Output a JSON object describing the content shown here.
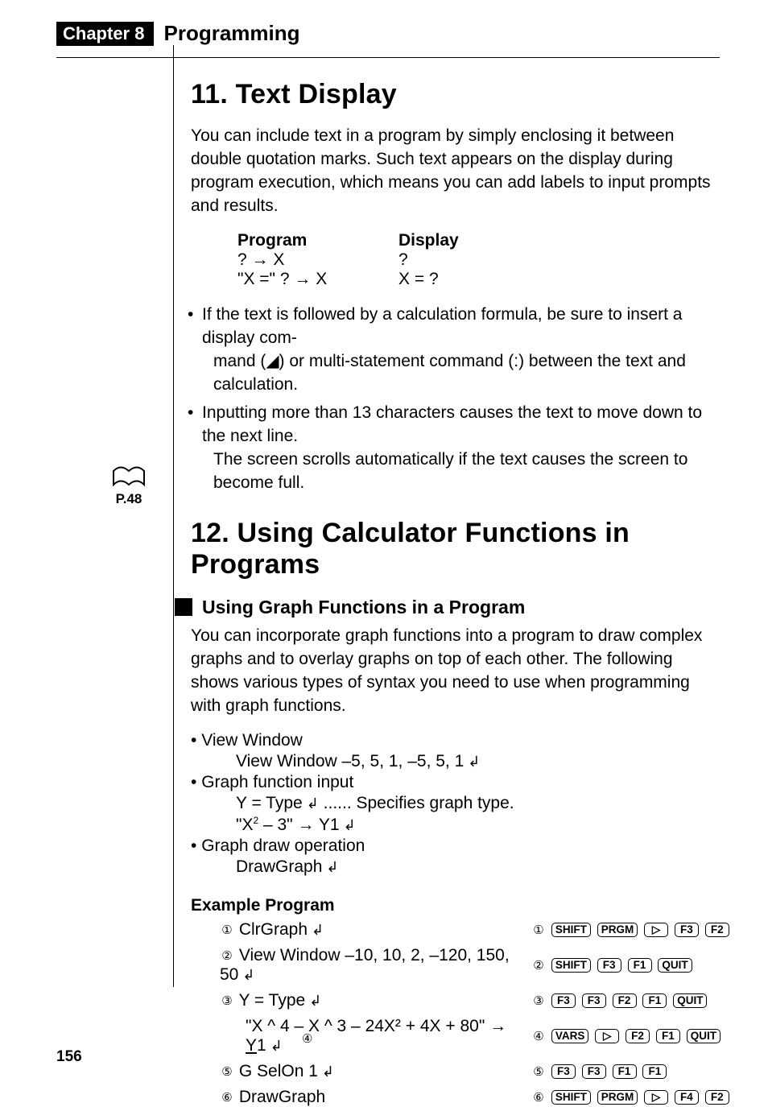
{
  "header": {
    "chapter_label": "Chapter 8",
    "chapter_title": "Programming"
  },
  "margin_ref": {
    "label": "P.48"
  },
  "s11": {
    "title": "11.  Text Display",
    "para": "You can include text in a program by simply enclosing it between double quotation marks. Such text appears on the display during program execution, which means you can add labels to input prompts and results.",
    "table_head_program": "Program",
    "table_head_display": "Display",
    "r1c1": "? → X",
    "r1c2": "?",
    "r2c1": "\"X =\" ? → X",
    "r2c2": "X = ?",
    "bullet1a": "If the text is followed by a calculation formula, be sure to insert a display com-",
    "bullet1b": "mand (◢) or multi-statement command (:) between the text and calculation.",
    "bullet2a": "Inputting more than 13 characters causes the text to move down to the next line.",
    "bullet2b": "The screen scrolls automatically if the text causes the screen to become full."
  },
  "s12": {
    "title": "12.  Using Calculator Functions in Programs",
    "subhead": "Using Graph Functions in a Program",
    "para": "You can incorporate graph functions into a program to draw complex graphs and to overlay graphs on top of each other. The following shows various types of syntax you need to use when programming with graph functions.",
    "vw_label": "View Window",
    "vw_body": "View Window  –5, 5, 1, –5, 5, 1",
    "gfi_label": "Graph function input",
    "gfi_a": "Y = Type",
    "gfi_a_tail": " ...... Specifies graph type.",
    "gfi_b_pre": "\"X",
    "gfi_b_post": " – 3\" → Y1",
    "gdo_label": "Graph draw operation",
    "gdo_a": "DrawGraph",
    "example_head": "Example Program",
    "ex1": "ClrGraph",
    "ex2": "View Window  –10, 10, 2, –120, 150, 50",
    "ex3": "Y = Type",
    "ex4": "\"X ^ 4 – X ^ 3 – 24X² + 4X + 80\" → ",
    "ex4_y1": "Y",
    "ex4_tail": "1",
    "ex5": "G SelOn 1",
    "ex6": "DrawGraph",
    "circ": {
      "c1": "①",
      "c2": "②",
      "c3": "③",
      "c4": "④",
      "c5": "⑤",
      "c6": "⑥"
    },
    "keys": {
      "shift": "SHIFT",
      "prgm": "PRGM",
      "vars": "VARS",
      "quit": "QUIT",
      "f1": "F1",
      "f2": "F2",
      "f3": "F3",
      "f4": "F4",
      "right": "▷"
    }
  },
  "page_number": "156"
}
